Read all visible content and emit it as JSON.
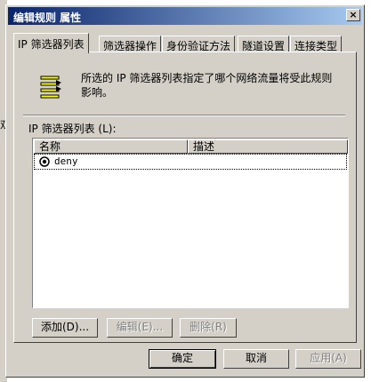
{
  "background": {
    "side_text": "双"
  },
  "window": {
    "title": "编辑规则 属性",
    "close_glyph": "×"
  },
  "tabs": [
    {
      "label": "IP 筛选器列表",
      "active": true
    },
    {
      "label": "筛选器操作",
      "active": false
    },
    {
      "label": "身份验证方法",
      "active": false
    },
    {
      "label": "隧道设置",
      "active": false
    },
    {
      "label": "连接类型",
      "active": false
    }
  ],
  "panel": {
    "icon": "filter-list-icon",
    "description": "所选的 IP 筛选器列表指定了哪个网络流量将受此规则影响。",
    "list_label": "IP 筛选器列表 (L):",
    "columns": [
      "名称",
      "描述"
    ],
    "rows": [
      {
        "name": "deny",
        "description": "",
        "selected": true
      }
    ]
  },
  "list_buttons": {
    "add": "添加(D)...",
    "edit": "编辑(E)...",
    "remove": "删除(R)"
  },
  "dialog_buttons": {
    "ok": "确定",
    "cancel": "取消",
    "apply": "应用(A)"
  },
  "colors": {
    "face": "#d4d0c8",
    "title_start": "#0a246a",
    "title_end": "#a6caf0",
    "icon_yellow": "#ffff00"
  }
}
